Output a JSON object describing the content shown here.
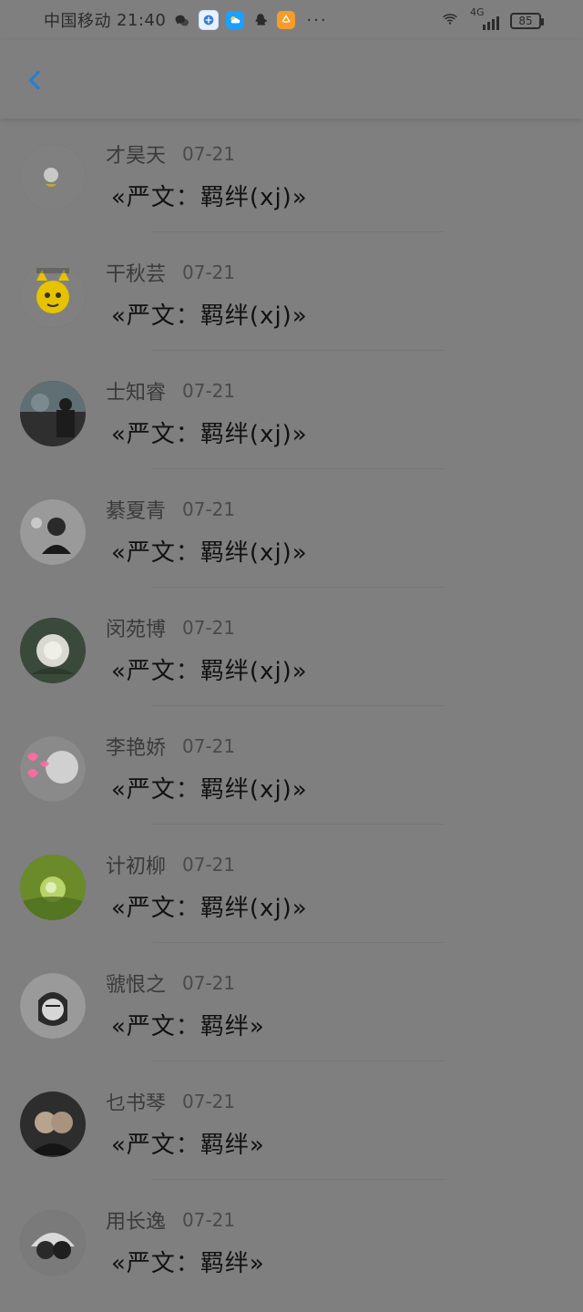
{
  "status_bar": {
    "carrier": "中国移动",
    "time": "21:40",
    "more": "···",
    "network": "4G",
    "battery": "85"
  },
  "nav": {
    "back_label": ""
  },
  "items": [
    {
      "name": "才昊天",
      "date": "07-21",
      "title": "«严文：羁绊(xj)»"
    },
    {
      "name": "干秋芸",
      "date": "07-21",
      "title": "«严文：羁绊(xj)»"
    },
    {
      "name": "士知睿",
      "date": "07-21",
      "title": "«严文：羁绊(xj)»"
    },
    {
      "name": "綦夏青",
      "date": "07-21",
      "title": "«严文：羁绊(xj)»"
    },
    {
      "name": "闵苑博",
      "date": "07-21",
      "title": "«严文：羁绊(xj)»"
    },
    {
      "name": "李艳娇",
      "date": "07-21",
      "title": "«严文：羁绊(xj)»"
    },
    {
      "name": "计初柳",
      "date": "07-21",
      "title": "«严文：羁绊(xj)»"
    },
    {
      "name": "虢恨之",
      "date": "07-21",
      "title": "«严文：羁绊»"
    },
    {
      "name": "乜书琴",
      "date": "07-21",
      "title": "«严文：羁绊»"
    },
    {
      "name": "用长逸",
      "date": "07-21",
      "title": "«严文：羁绊»"
    }
  ],
  "colors": {
    "overlay_gray": "#7f7f7f",
    "back_blue": "#1f7fd6",
    "text_primary": "#111111",
    "text_secondary": "#3a3a3a"
  },
  "icons": {
    "back": "chevron-left-icon",
    "wifi": "wifi-icon",
    "signal": "signal-icon",
    "battery": "battery-icon"
  }
}
